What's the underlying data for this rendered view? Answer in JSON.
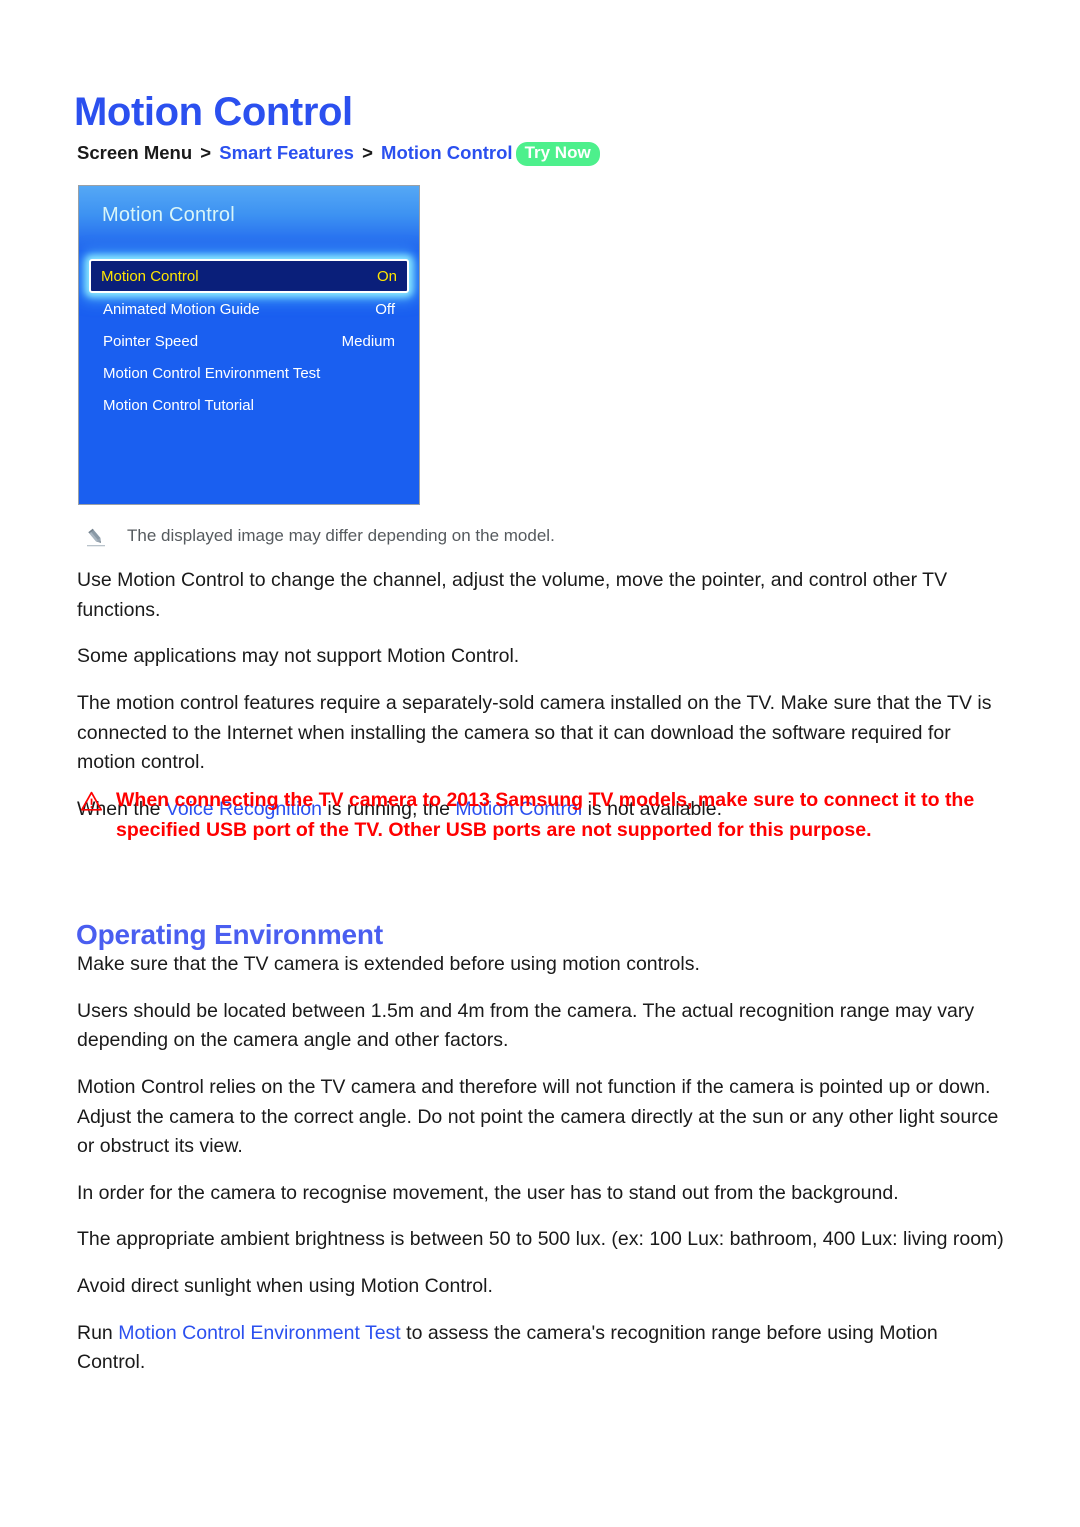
{
  "document": {
    "title": "Motion Control",
    "section_heading": "Operating Environment"
  },
  "breadcrumb": {
    "root": "Screen Menu",
    "separator": ">",
    "level2": "Smart Features",
    "level3": "Motion Control",
    "badge": "Try Now"
  },
  "tv_panel": {
    "header_title": "Motion Control",
    "rows": [
      {
        "label": "Motion Control",
        "value": "On",
        "selected": true
      },
      {
        "label": "Animated Motion Guide",
        "value": "Off",
        "selected": false
      },
      {
        "label": "Pointer Speed",
        "value": "Medium",
        "selected": false
      },
      {
        "label": "Motion Control Environment Test",
        "value": "",
        "selected": false
      },
      {
        "label": "Motion Control Tutorial",
        "value": "",
        "selected": false
      }
    ]
  },
  "note": {
    "icon": "pencil-icon",
    "text": "The displayed image may differ depending on the model."
  },
  "intro_paragraphs": {
    "p1": "Use Motion Control to change the channel, adjust the volume, move the pointer, and control other TV functions.",
    "p2": "Some applications may not support Motion Control.",
    "p3": "The motion control features require a separately-sold camera installed on the TV. Make sure that the TV is connected to the Internet when installing the camera so that it can download the software required for motion control.",
    "p4_part1": "When the ",
    "p4_link1": "Voice Recognition",
    "p4_part2": " is running, the ",
    "p4_link2": "Motion Control",
    "p4_part3": " is not available."
  },
  "warning": {
    "icon": "warning-triangle-icon",
    "text": "When connecting the TV camera to 2013 Samsung TV models, make sure to connect it to the specified USB port of the TV. Other USB ports are not supported for this purpose.",
    "color": "#ff0000"
  },
  "environment_paragraphs": {
    "p1": "Make sure that the TV camera is extended before using motion controls.",
    "p2": "Users should be located between 1.5m and 4m from the camera. The actual recognition range may vary depending on the camera angle and other factors.",
    "p3": "Motion Control relies on the TV camera and therefore will not function if the camera is pointed up or down. Adjust the camera to the correct angle. Do not point the camera directly at the sun or any other light source or obstruct its view.",
    "p4": "In order for the camera to recognise movement, the user has to stand out from the background.",
    "p5": "The appropriate ambient brightness is between 50 to 500 lux. (ex: 100 Lux: bathroom, 400 Lux: living room)",
    "p6": "Avoid direct sunlight when using Motion Control.",
    "p7_part1": "Run ",
    "p7_link": "Motion Control Environment Test",
    "p7_part2": " to assess the camera's recognition range before using Motion Control."
  },
  "colors": {
    "heading_blue": "#2b50ef",
    "section_blue": "#4a5ef0",
    "link_blue": "#2b50ef",
    "badge_green": "#4df08c",
    "warning_red": "#ff0000",
    "tv_panel_blue": "#1a5ff0",
    "tv_selected_navy": "#0a1f7a",
    "tv_selected_text": "#ffe500"
  }
}
